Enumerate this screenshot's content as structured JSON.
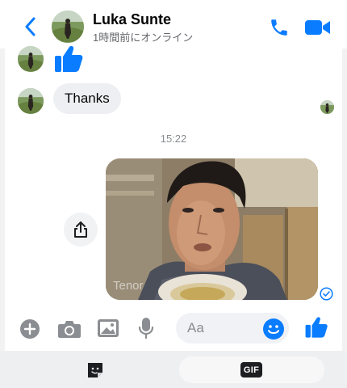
{
  "header": {
    "contact_name": "Luka Sunte",
    "status": "1時間前にオンライン",
    "back_icon": "chevron-left-icon",
    "call_icon": "phone-icon",
    "video_icon": "video-camera-icon"
  },
  "conversation": {
    "messages": [
      {
        "type": "like",
        "icon": "thumbs-up-icon",
        "direction": "incoming"
      },
      {
        "type": "text",
        "text": "Thanks",
        "direction": "incoming"
      },
      {
        "type": "video",
        "direction": "outgoing",
        "watermark": "Tenor"
      }
    ],
    "timestamp": "15:22"
  },
  "composer": {
    "placeholder": "Aa",
    "tools": [
      "plus-icon",
      "camera-icon",
      "gallery-icon",
      "microphone-icon"
    ],
    "emoji_icon": "smiley-icon",
    "like_icon": "thumbs-up-icon"
  },
  "tray": {
    "sticker_icon": "sticker-icon",
    "gif_label": "GIF"
  },
  "colors": {
    "accent": "#0a7cff",
    "incoming_bubble": "#eeeff2",
    "secondary_text": "#65676b",
    "tool_gray": "#8a8d91",
    "tray_background": "#eeeff1"
  }
}
